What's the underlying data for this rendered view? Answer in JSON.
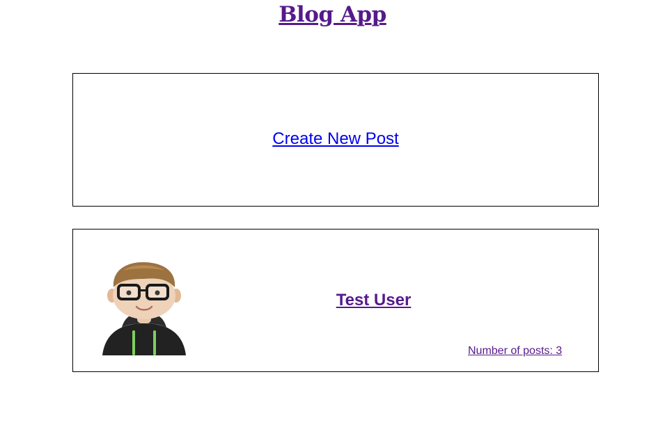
{
  "header": {
    "title": "Blog App"
  },
  "create_post": {
    "link_label": "Create New Post"
  },
  "user_card": {
    "name": "Test User",
    "posts_label": "Number of posts: 3",
    "avatar_icon": "user-avatar-3d-glasses-hoodie"
  },
  "colors": {
    "visited_link": "#551a8b",
    "link": "#0000ee",
    "border": "#000000"
  }
}
